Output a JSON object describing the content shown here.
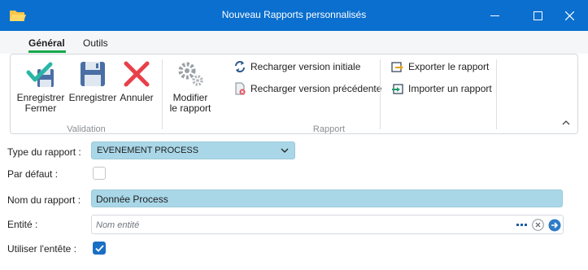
{
  "window": {
    "title": "Nouveau Rapports personnalisés"
  },
  "tabs": [
    {
      "label": "Général",
      "active": true
    },
    {
      "label": "Outils",
      "active": false
    }
  ],
  "ribbon": {
    "validation": {
      "label": "Validation",
      "save_close": "Enregistrer\nFermer",
      "save": "Enregistrer",
      "cancel": "Annuler"
    },
    "rapport": {
      "label": "Rapport",
      "modify": "Modifier\nle rapport",
      "reload_initial": "Recharger version initiale",
      "reload_previous": "Recharger version précédente",
      "export": "Exporter le rapport",
      "import": "Importer un rapport"
    }
  },
  "form": {
    "type_label": "Type du rapport :",
    "type_value": "EVENEMENT PROCESS",
    "default_label": "Par défaut :",
    "default_checked": false,
    "name_label": "Nom du rapport :",
    "name_value": "Donnée Process",
    "entity_label": "Entité :",
    "entity_placeholder": "Nom entité",
    "header_label": "Utiliser l'entête :",
    "header_checked": true
  },
  "colors": {
    "titlebar": "#0a6fce",
    "field_bg": "#a9d7e8",
    "tab_accent": "#18a84a",
    "checkbox": "#1a6fc4"
  }
}
